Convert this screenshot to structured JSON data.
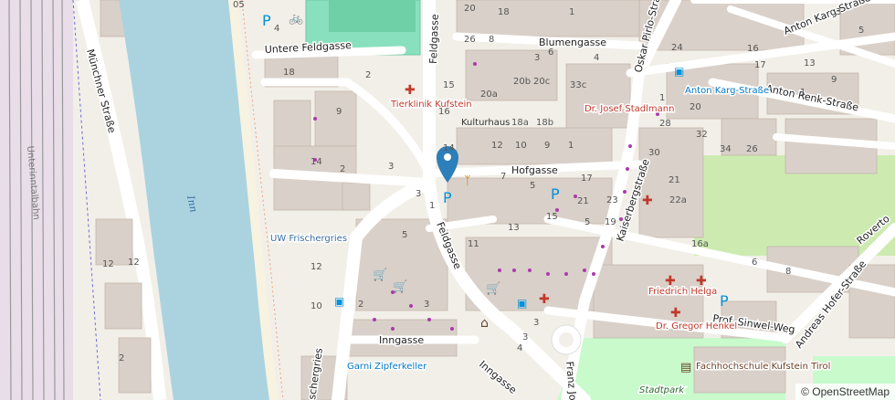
{
  "map": {
    "streets": {
      "blumengasse": "Blumengasse",
      "anton_karg_strasse_top": "Anton Karg-Straße",
      "untere_feldgasse": "Untere Feldgasse",
      "muenchner_strasse": "Münchner Straße",
      "feldgasse_top": "Feldgasse",
      "feldgasse_mid": "Feldgasse",
      "oskar_pirlo_strasse": "Oskar Pirlo-Straße",
      "anton_renk_strasse": "Anton Renk-Straße",
      "hofgasse": "Hofgasse",
      "kaiserbergstrasse": "Kaiserbergstraße",
      "inngasse_left": "Inngasse",
      "inngasse_bottom": "Inngasse",
      "prof_sinwel_weg": "Prof. Sinwel-Weg",
      "andreas_hofer_strasse": "Andreas Hofer-Straße",
      "roverto": "Roverto",
      "franz_jos": "Franz Jos",
      "schergries": "schergries"
    },
    "water": {
      "inn": "Inn"
    },
    "places": {
      "unterinntalbahn": "Unterinntalbahn",
      "uw_frischergries": "UW Frischergries",
      "kulturhaus": "Kulturhaus",
      "anton_karg_strasse_stop": "Anton Karg-Straße",
      "stadtpark": "Stadtpark"
    },
    "pois": {
      "tierklinik": "Tierklinik Kufstein",
      "dr_josef": "Dr. Josef Stadlmann",
      "friedrich_helga": "Friedrich Helga",
      "dr_gregor": "Dr. Gregor Henkel",
      "garni": "Garni Zipferkeller",
      "fachhochschule": "Fachhochschule Kufstein Tirol"
    },
    "house_numbers": [
      "05",
      "20",
      "26",
      "18",
      "2",
      "4",
      "15",
      "16",
      "9",
      "3",
      "14",
      "12",
      "14",
      "3",
      "5",
      "12",
      "10",
      "12",
      "2",
      "20b",
      "20a",
      "18a",
      "18b",
      "20c",
      "33c",
      "3",
      "4",
      "18",
      "1",
      "6",
      "8",
      "10",
      "12",
      "9",
      "1",
      "11",
      "3",
      "2",
      "3",
      "4",
      "3",
      "2",
      "1",
      "5",
      "17",
      "21",
      "15",
      "23",
      "19",
      "13",
      "5",
      "7",
      "16a",
      "22a",
      "21",
      "32",
      "34",
      "26",
      "28",
      "30",
      "20",
      "1",
      "24",
      "16",
      "17",
      "13",
      "9",
      "5",
      "3",
      "1",
      "6",
      "8"
    ],
    "colors": {
      "background": "#f2efe9",
      "river": "#aad3df",
      "building": "#d9d0c9",
      "major_road": "#ffffff",
      "rail": "#a0a0a0",
      "park": "#c8facc",
      "sports": "#88e0be",
      "poi_red": "#c0392b",
      "poi_blue": "#0092da",
      "poi_purple": "#ac39ac",
      "marker": "#2c7fb8"
    },
    "icons": [
      "parking-icon",
      "bicycle-parking-icon",
      "bus-stop-icon",
      "pharmacy-icon",
      "doctor-icon",
      "veterinary-icon",
      "shop-icon",
      "restaurant-icon",
      "museum-icon",
      "library-icon",
      "location-marker-icon",
      "arrow-icon"
    ]
  },
  "attribution": "© OpenStreetMap"
}
